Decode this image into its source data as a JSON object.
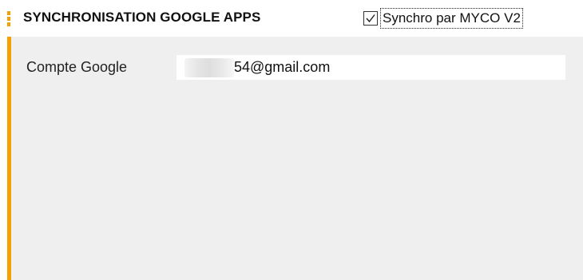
{
  "header": {
    "title": "SYNCHRONISATION GOOGLE APPS",
    "accent_color": "#f5a000"
  },
  "sync_option": {
    "label": "Synchro par MYCO V2",
    "checked": true
  },
  "google_account": {
    "label": "Compte Google",
    "value": "54@gmail.com",
    "redacted_prefix": true
  },
  "icons": {
    "checkbox": "check-icon"
  }
}
